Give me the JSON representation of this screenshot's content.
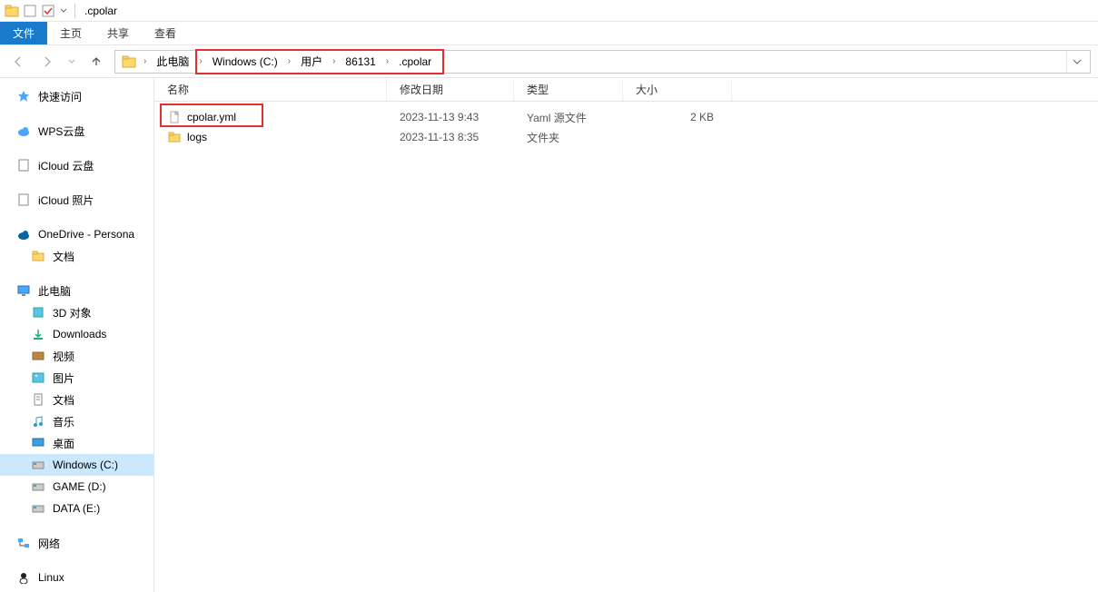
{
  "title": ".cpolar",
  "menu": {
    "file": "文件",
    "home": "主页",
    "share": "共享",
    "view": "查看"
  },
  "breadcrumb": {
    "root": "此电脑",
    "parts": [
      "Windows (C:)",
      "用户",
      "86131",
      ".cpolar"
    ]
  },
  "columns": {
    "name": "名称",
    "date": "修改日期",
    "type": "类型",
    "size": "大小"
  },
  "files": [
    {
      "name": "cpolar.yml",
      "date": "2023-11-13 9:43",
      "type": "Yaml 源文件",
      "size": "2 KB",
      "icon": "file"
    },
    {
      "name": "logs",
      "date": "2023-11-13 8:35",
      "type": "文件夹",
      "size": "",
      "icon": "folder"
    }
  ],
  "sidebar": {
    "quick": "快速访问",
    "wps": "WPS云盘",
    "icloud_drive": "iCloud 云盘",
    "icloud_photos": "iCloud 照片",
    "onedrive": "OneDrive - Persona",
    "onedrive_docs": "文档",
    "thispc": "此电脑",
    "items": [
      {
        "label": "3D 对象"
      },
      {
        "label": "Downloads"
      },
      {
        "label": "视频"
      },
      {
        "label": "图片"
      },
      {
        "label": "文档"
      },
      {
        "label": "音乐"
      },
      {
        "label": "桌面"
      },
      {
        "label": "Windows (C:)",
        "selected": true
      },
      {
        "label": "GAME (D:)"
      },
      {
        "label": "DATA (E:)"
      }
    ],
    "network": "网络",
    "linux": "Linux"
  }
}
